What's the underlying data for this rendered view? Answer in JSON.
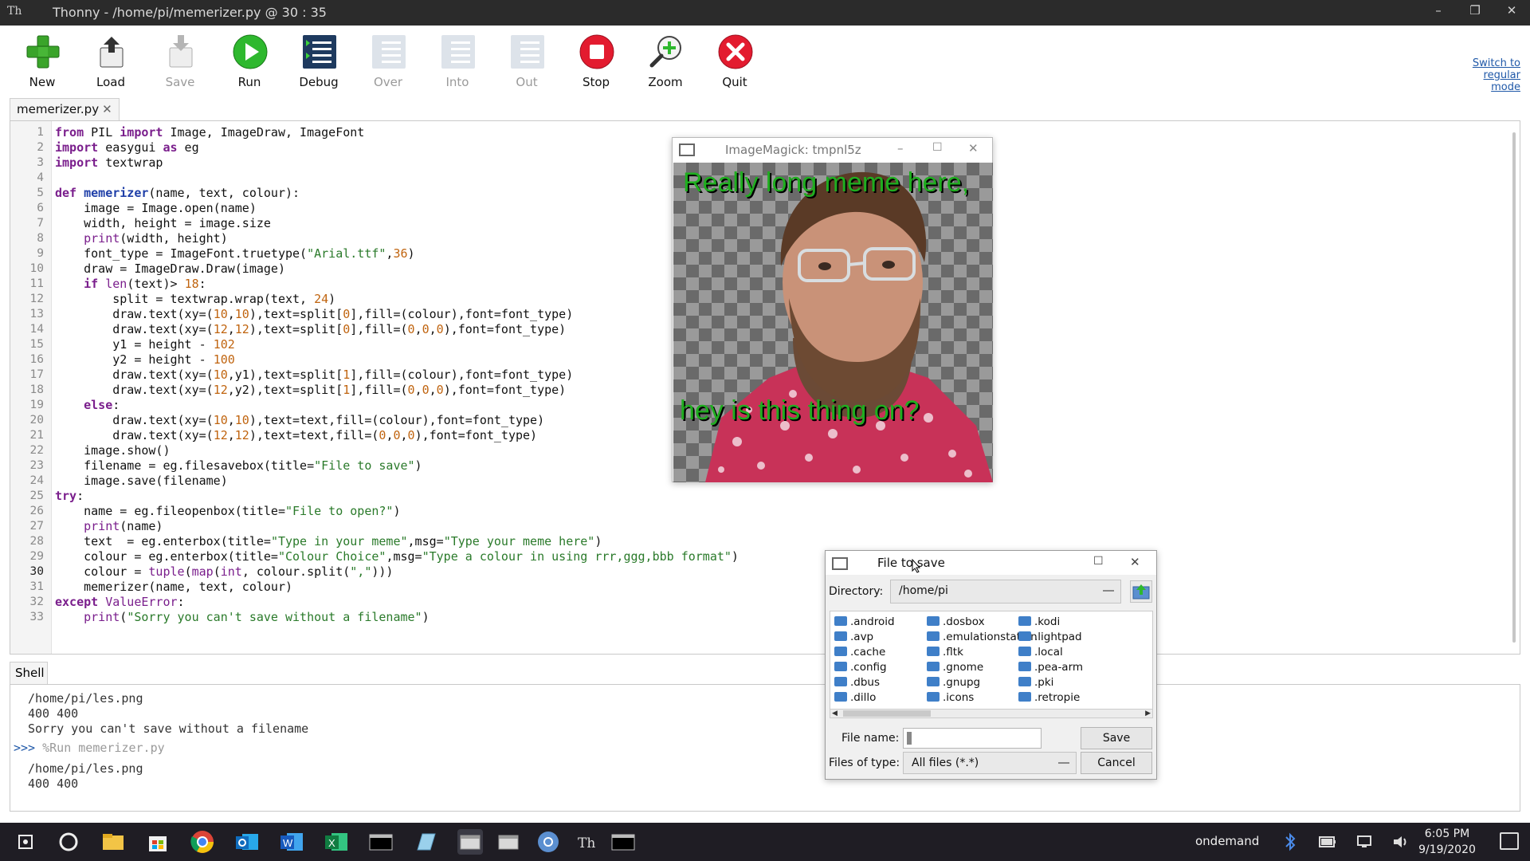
{
  "window": {
    "title": "Thonny  -  /home/pi/memerizer.py  @  30 : 35",
    "app_icon": "Th",
    "minimize_label": "–",
    "maximize_label": "❐",
    "close_label": "✕"
  },
  "toolbar": {
    "items": [
      {
        "label": "New",
        "icon": "new-icon",
        "enabled": true
      },
      {
        "label": "Load",
        "icon": "load-icon",
        "enabled": true
      },
      {
        "label": "Save",
        "icon": "save-icon",
        "enabled": false
      },
      {
        "label": "Run",
        "icon": "run-icon",
        "enabled": true
      },
      {
        "label": "Debug",
        "icon": "debug-icon",
        "enabled": true
      },
      {
        "label": "Over",
        "icon": "step-over-icon",
        "enabled": false
      },
      {
        "label": "Into",
        "icon": "step-into-icon",
        "enabled": false
      },
      {
        "label": "Out",
        "icon": "step-out-icon",
        "enabled": false
      },
      {
        "label": "Stop",
        "icon": "stop-icon",
        "enabled": true
      },
      {
        "label": "Zoom",
        "icon": "zoom-icon",
        "enabled": true
      },
      {
        "label": "Quit",
        "icon": "quit-icon",
        "enabled": true
      }
    ],
    "switch_mode": [
      "Switch to",
      "regular",
      "mode"
    ]
  },
  "editor": {
    "tab_label": "memerizer.py",
    "tab_close": "✕",
    "line_numbers": [
      "1",
      "2",
      "3",
      "4",
      "5",
      "6",
      "7",
      "8",
      "9",
      "10",
      "11",
      "12",
      "13",
      "14",
      "15",
      "16",
      "17",
      "18",
      "19",
      "20",
      "21",
      "22",
      "23",
      "24",
      "25",
      "26",
      "27",
      "28",
      "29",
      "30",
      "31",
      "32",
      "33"
    ],
    "code_lines": [
      "from PIL import Image, ImageDraw, ImageFont",
      "import easygui as eg",
      "import textwrap",
      "",
      "def memerizer(name, text, colour):",
      "    image = Image.open(name)",
      "    width, height = image.size",
      "    print(width, height)",
      "    font_type = ImageFont.truetype(\"Arial.ttf\",36)",
      "    draw = ImageDraw.Draw(image)",
      "    if len(text)> 18:",
      "        split = textwrap.wrap(text, 24)",
      "        draw.text(xy=(10,10),text=split[0],fill=(colour),font=font_type)",
      "        draw.text(xy=(12,12),text=split[0],fill=(0,0,0),font=font_type)",
      "        y1 = height - 102",
      "        y2 = height - 100",
      "        draw.text(xy=(10,y1),text=split[1],fill=(colour),font=font_type)",
      "        draw.text(xy=(12,y2),text=split[1],fill=(0,0,0),font=font_type)",
      "    else:",
      "        draw.text(xy=(10,10),text=text,fill=(colour),font=font_type)",
      "        draw.text(xy=(12,12),text=text,fill=(0,0,0),font=font_type)",
      "    image.show()",
      "    filename = eg.filesavebox(title=\"File to save\")",
      "    image.save(filename)",
      "try:",
      "    name = eg.fileopenbox(title=\"File to open?\")",
      "    print(name)",
      "    text  = eg.enterbox(title=\"Type in your meme\",msg=\"Type your meme here\")",
      "    colour = eg.enterbox(title=\"Colour Choice\",msg=\"Type a colour in using rrr,ggg,bbb format\")",
      "    colour = tuple(map(int, colour.split(\",\")))",
      "    memerizer(name, text, colour)",
      "except ValueError:",
      "    print(\"Sorry you can't save without a filename\")"
    ]
  },
  "shell": {
    "tab_label": "Shell",
    "lines": [
      "/home/pi/les.png",
      "400 400",
      "Sorry you can't save without a filename"
    ],
    "prompt": ">>>",
    "command": "%Run memerizer.py",
    "lines_after": [
      "/home/pi/les.png",
      "400 400"
    ]
  },
  "image_window": {
    "title": "ImageMagick: tmpnl5z",
    "top_text": "Really long meme here,",
    "bottom_text": "hey is this thing on?"
  },
  "file_dialog": {
    "title": "File to save",
    "directory_label": "Directory:",
    "directory_value": "/home/pi",
    "folders": [
      ".android",
      ".avp",
      ".cache",
      ".config",
      ".dbus",
      ".dillo",
      ".dosbox",
      ".emulationstation",
      ".fltk",
      ".gnome",
      ".gnupg",
      ".icons",
      ".kodi",
      ".lightpad",
      ".local",
      ".pea-arm",
      ".pki",
      ".retropie"
    ],
    "file_name_label": "File name:",
    "file_name_value": "",
    "save_button": "Save",
    "files_of_type_label": "Files of type:",
    "files_of_type_value": "All files (*.*)",
    "cancel_button": "Cancel"
  },
  "taskbar": {
    "cpu_governor": "ondemand",
    "time": "6:05 PM",
    "date": "9/19/2020"
  },
  "colors": {
    "keyword": "#7a1e8c",
    "builtin": "#7a1e8c",
    "string": "#2a7a2a",
    "number": "#c0640f",
    "meme_text": "#1fae1f"
  }
}
